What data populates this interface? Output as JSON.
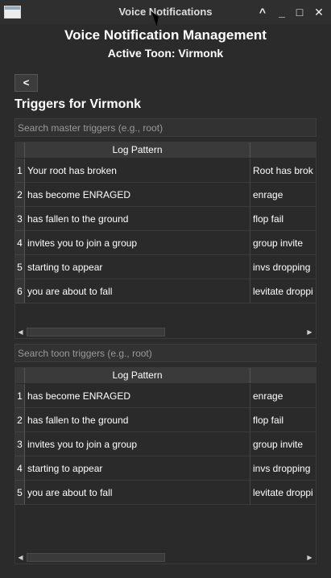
{
  "window": {
    "title": "Voice Notifications",
    "controls": {
      "collapse": "^",
      "minimize": "_",
      "maximize": "□",
      "close": "✕"
    }
  },
  "header": {
    "title": "Voice Notification Management",
    "subtitle": "Active Toon: Virmonk"
  },
  "back_button": {
    "label": "<"
  },
  "section_title": "Triggers for Virmonk",
  "master_search": {
    "placeholder": "Search master triggers (e.g., root)",
    "value": ""
  },
  "master_table": {
    "columns": [
      "Log Pattern",
      ""
    ],
    "rows": [
      {
        "num": "1",
        "pattern": "Your root has broken",
        "name": "Root has brok"
      },
      {
        "num": "2",
        "pattern": "has become ENRAGED",
        "name": "enrage"
      },
      {
        "num": "3",
        "pattern": "has fallen to the ground",
        "name": "flop fail"
      },
      {
        "num": "4",
        "pattern": "invites you to join a group",
        "name": "group invite"
      },
      {
        "num": "5",
        "pattern": "starting to appear",
        "name": "invs dropping"
      },
      {
        "num": "6",
        "pattern": "you are about to fall",
        "name": "levitate droppi"
      }
    ]
  },
  "toon_search": {
    "placeholder": "Search toon triggers (e.g., root)",
    "value": ""
  },
  "toon_table": {
    "columns": [
      "Log Pattern",
      ""
    ],
    "rows": [
      {
        "num": "1",
        "pattern": "has become ENRAGED",
        "name": "enrage"
      },
      {
        "num": "2",
        "pattern": "has fallen to the ground",
        "name": "flop fail"
      },
      {
        "num": "3",
        "pattern": "invites you to join a group",
        "name": "group invite"
      },
      {
        "num": "4",
        "pattern": "starting to appear",
        "name": "invs dropping"
      },
      {
        "num": "5",
        "pattern": "you are about to fall",
        "name": "levitate droppi"
      }
    ]
  },
  "scroll": {
    "left_arrow": "◀",
    "right_arrow": "▶"
  }
}
